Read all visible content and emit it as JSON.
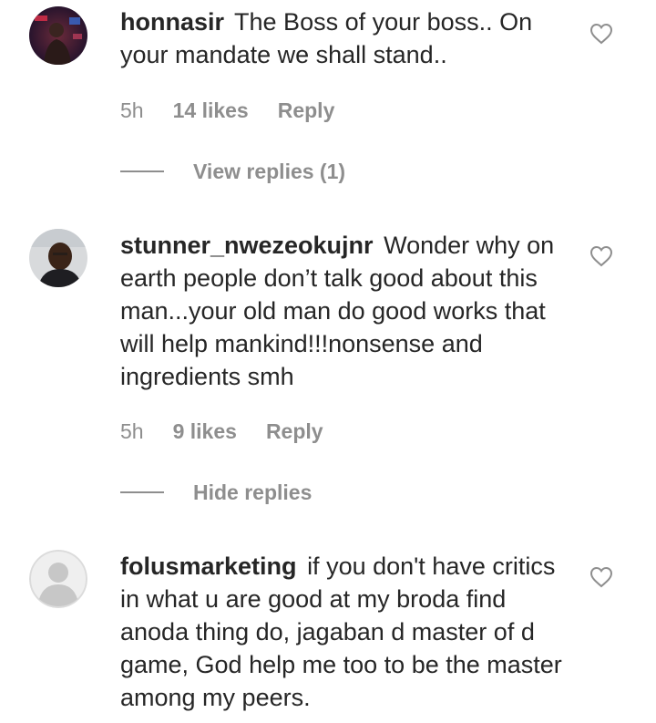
{
  "comments": [
    {
      "username": "honnasir",
      "text": "The Boss of your boss.. On your mandate we shall stand..",
      "time": "5h",
      "likes": "14 likes",
      "reply": "Reply",
      "thread_label": "View replies (1)",
      "avatar": "profile-photo"
    },
    {
      "username": "stunner_nwezeokujnr",
      "text": "Wonder why on earth people don’t talk good about this man...your old man do good works that will help mankind!!!nonsense and ingredients smh",
      "time": "5h",
      "likes": "9 likes",
      "reply": "Reply",
      "thread_label": "Hide replies",
      "avatar": "profile-photo"
    },
    {
      "username": "folusmarketing",
      "text": "if you don't have critics in what u are good at my broda find anoda thing do, jagaban d master of d game, God help me too to be the master among my peers.",
      "avatar": "default-avatar"
    }
  ],
  "icons": {
    "like": "heart-outline-icon"
  },
  "colors": {
    "text": "#262626",
    "secondary": "#8e8e8e",
    "background": "#ffffff"
  }
}
